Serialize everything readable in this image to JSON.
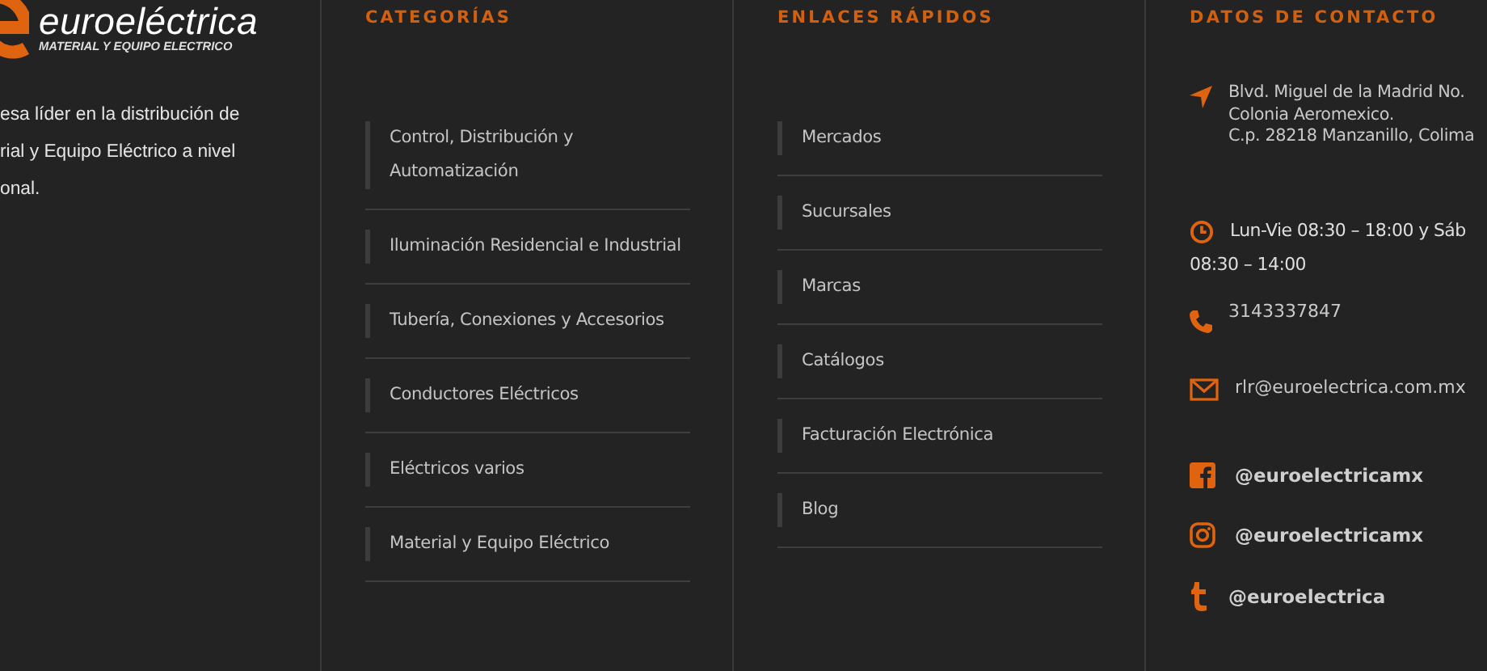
{
  "brand": {
    "name": "euroeléctrica",
    "tagline": "MATERIAL Y EQUIPO ELECTRICO"
  },
  "intro_lines": [
    "esa líder en la distribución de",
    "rial y Equipo Eléctrico a nivel",
    "onal."
  ],
  "columns": [
    {
      "heading": "CATEGORÍAS",
      "items": [
        "Control, Distribución y Automatización",
        "Iluminación Residencial e Industrial",
        "Tubería, Conexiones y Accesorios",
        "Conductores Eléctricos",
        "Eléctricos varios",
        "Material y Equipo Eléctrico"
      ]
    },
    {
      "heading": "ENLACES RÁPIDOS",
      "items": [
        "Mercados",
        "Sucursales",
        "Marcas",
        "Catálogos",
        "Facturación Electrónica",
        "Blog"
      ]
    }
  ],
  "contact": {
    "heading": "DATOS DE CONTACTO",
    "address": [
      "Blvd. Miguel de la Madrid No.",
      "Colonia Aeromexico.",
      "C.p. 28218 Manzanillo, Colima"
    ],
    "hours": [
      "Lun-Vie 08:30 – 18:00 y Sáb",
      "08:30 – 14:00"
    ],
    "phone": "3143337847",
    "email": "rlr@euroelectrica.com.mx",
    "social": [
      {
        "kind": "facebook",
        "handle": "@euroelectricamx"
      },
      {
        "kind": "instagram",
        "handle": "@euroelectricamx"
      },
      {
        "kind": "tumblr",
        "handle": "@euroelectrica"
      }
    ]
  }
}
